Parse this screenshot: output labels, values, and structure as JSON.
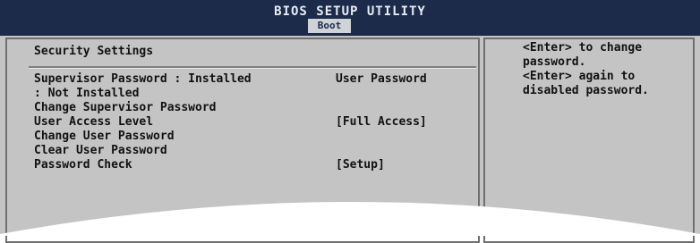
{
  "header": {
    "title": "BIOS SETUP UTILITY",
    "tab": "Boot"
  },
  "main": {
    "heading": "Security Settings",
    "rows": [
      {
        "label": "Supervisor Password  : Installed",
        "value": "User Password"
      },
      {
        "label": ": Not Installed",
        "value": ""
      },
      {
        "label": "Change Supervisor Password",
        "value": ""
      },
      {
        "label": "User Access Level",
        "value": "[Full Access]"
      },
      {
        "label": "Change User Password",
        "value": ""
      },
      {
        "label": "Clear User Password",
        "value": ""
      },
      {
        "label": "Password Check",
        "value": "[Setup]"
      }
    ]
  },
  "help": {
    "lines": [
      "<Enter> to change",
      "password.",
      "<Enter> again to",
      "disabled password."
    ]
  }
}
